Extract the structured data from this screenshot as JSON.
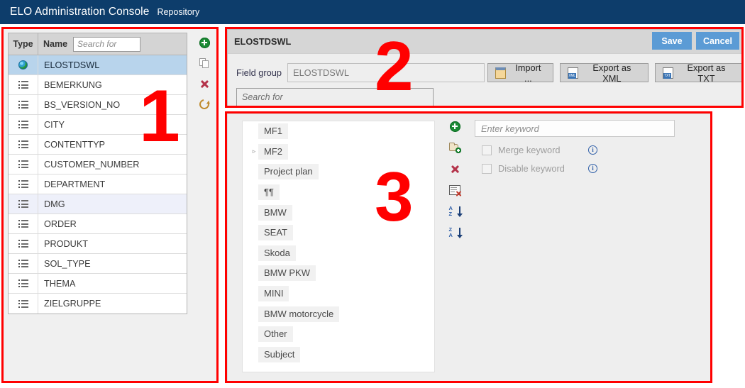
{
  "titlebar": {
    "app_title": "ELO Administration Console",
    "section": "Repository"
  },
  "annotations": [
    {
      "number": "1"
    },
    {
      "number": "2"
    },
    {
      "number": "3"
    }
  ],
  "left_panel": {
    "columns": {
      "type": "Type",
      "name": "Name"
    },
    "search_placeholder": "Search for",
    "search_value": "",
    "rows": [
      {
        "icon": "globe-icon",
        "name": "ELOSTDSWL",
        "state": "selected"
      },
      {
        "icon": "list-icon",
        "name": "BEMERKUNG",
        "state": "normal"
      },
      {
        "icon": "list-icon",
        "name": "BS_VERSION_NO",
        "state": "normal"
      },
      {
        "icon": "list-icon",
        "name": "CITY",
        "state": "normal"
      },
      {
        "icon": "list-icon",
        "name": "CONTENTTYP",
        "state": "normal"
      },
      {
        "icon": "list-icon",
        "name": "CUSTOMER_NUMBER",
        "state": "normal"
      },
      {
        "icon": "list-icon",
        "name": "DEPARTMENT",
        "state": "normal"
      },
      {
        "icon": "list-icon",
        "name": "DMG",
        "state": "alt"
      },
      {
        "icon": "list-icon",
        "name": "ORDER",
        "state": "normal"
      },
      {
        "icon": "list-icon",
        "name": "PRODUKT",
        "state": "normal"
      },
      {
        "icon": "list-icon",
        "name": "SOL_TYPE",
        "state": "normal"
      },
      {
        "icon": "list-icon",
        "name": "THEMA",
        "state": "normal"
      },
      {
        "icon": "list-icon",
        "name": "ZIELGRUPPE",
        "state": "normal"
      }
    ],
    "toolbar": [
      {
        "icon": "add-icon",
        "tooltip": "New"
      },
      {
        "icon": "copy-icon",
        "tooltip": "Copy"
      },
      {
        "icon": "delete-icon",
        "tooltip": "Delete"
      },
      {
        "icon": "refresh-icon",
        "tooltip": "Refresh"
      }
    ]
  },
  "panel2": {
    "title": "ELOSTDSWL",
    "save_label": "Save",
    "cancel_label": "Cancel",
    "field_group_label": "Field group",
    "field_group_value": "ELOSTDSWL",
    "search_placeholder": "Search for",
    "search_value": "",
    "buttons": [
      {
        "label": "Import ...",
        "icon": "import-icon"
      },
      {
        "label": "Export as XML",
        "icon": "xml-file-icon",
        "tag": "XML"
      },
      {
        "label": "Export as TXT",
        "icon": "txt-file-icon",
        "tag": "TXT"
      }
    ]
  },
  "panel3": {
    "tree": [
      {
        "label": "MF1",
        "expandable": false
      },
      {
        "label": "MF2",
        "expandable": true
      },
      {
        "label": "Project plan",
        "expandable": false
      },
      {
        "label": "¶¶",
        "expandable": false
      },
      {
        "label": "BMW",
        "expandable": false
      },
      {
        "label": "SEAT",
        "expandable": false
      },
      {
        "label": "Skoda",
        "expandable": false
      },
      {
        "label": "BMW PKW",
        "expandable": false
      },
      {
        "label": "MINI",
        "expandable": false
      },
      {
        "label": "BMW motorcycle",
        "expandable": false
      },
      {
        "label": "Other",
        "expandable": false
      },
      {
        "label": "Subject",
        "expandable": false
      }
    ],
    "toolbar": [
      {
        "icon": "add-icon",
        "tooltip": "New keyword"
      },
      {
        "icon": "add-folder-icon",
        "tooltip": "New sub-keyword"
      },
      {
        "icon": "delete-icon",
        "tooltip": "Delete keyword"
      },
      {
        "icon": "clear-form-icon",
        "tooltip": "Clear"
      },
      {
        "icon": "sort-az-icon",
        "tooltip": "Sort ascending",
        "letters_top": "A",
        "letters_bottom": "Z"
      },
      {
        "icon": "sort-za-icon",
        "tooltip": "Sort descending",
        "letters_top": "Z",
        "letters_bottom": "A"
      }
    ],
    "keyword_placeholder": "Enter keyword",
    "keyword_value": "",
    "checkboxes": [
      {
        "label": "Merge keyword",
        "checked": false,
        "info": "ⓘ"
      },
      {
        "label": "Disable keyword",
        "checked": false,
        "info": "ⓘ"
      }
    ]
  },
  "colors": {
    "titlebar_bg": "#0d3d6b",
    "annotation_red": "#ff0000",
    "accent_blue": "#5b9bd5",
    "selected_row": "#b8d4ec",
    "alt_row": "#eef0fa",
    "panel_gray": "#d6d6d6"
  }
}
